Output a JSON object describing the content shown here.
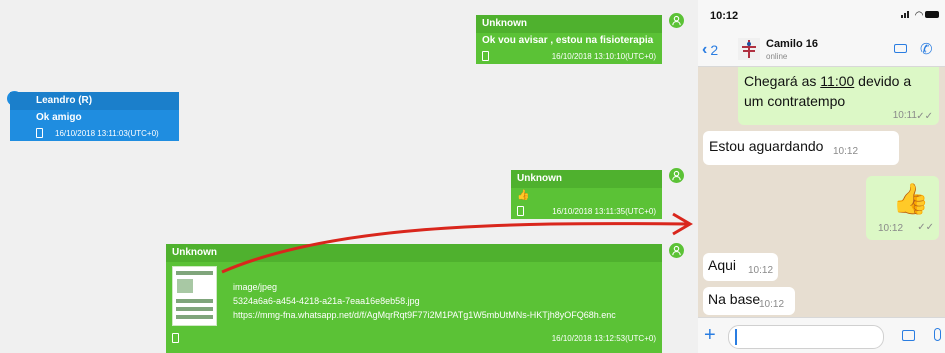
{
  "report": {
    "messages": [
      {
        "sender": "Unknown",
        "text": "Ok vou avisar , estou na fisioterapia",
        "timestamp": "16/10/2018 13:10:10(UTC+0)"
      },
      {
        "sender": "Leandro (R)",
        "text": "Ok amigo",
        "timestamp": "16/10/2018 13:11:03(UTC+0)"
      },
      {
        "sender": "Unknown",
        "text": "👍",
        "timestamp": "16/10/2018 13:11:35(UTC+0)"
      },
      {
        "sender": "Unknown",
        "mime": "image/jpeg",
        "filename": "5324a6a6-a454-4218-a21a-7eaa16e8eb58.jpg",
        "url": "https://mmg-fna.whatsapp.net/d/f/AgMqrRqt9F77i2M1PATg1W5mbUtMNs-HKTjh8yOFQ68h.enc",
        "timestamp": "16/10/2018 13:12:53(UTC+0)"
      }
    ],
    "colors": {
      "outgoing": "#5bc236",
      "incoming": "#1f8de0",
      "arrow": "#d9261c"
    }
  },
  "phone": {
    "status_time": "10:12",
    "back_count": "2",
    "contact_name": "Camilo 16",
    "contact_status": "online",
    "bubbles": [
      {
        "type": "sent",
        "text_pre": "Chegará as ",
        "text_link": "11:00",
        "text_post": " devido a um contratempo",
        "time": "10:11",
        "ticks": "✓✓"
      },
      {
        "type": "received",
        "text": "Estou aguardando",
        "time": "10:12"
      },
      {
        "type": "sent",
        "emoji": "👍",
        "time": "10:12",
        "ticks": "✓✓"
      },
      {
        "type": "received",
        "text": "Aqui",
        "time": "10:12"
      },
      {
        "type": "received",
        "text": "Na base",
        "time": "10:12"
      }
    ]
  }
}
